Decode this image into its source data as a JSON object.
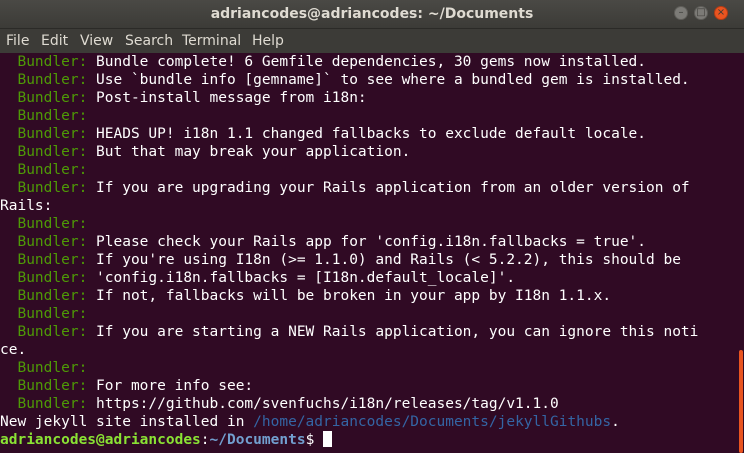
{
  "window": {
    "title": "adriancodes@adriancodes: ~/Documents"
  },
  "menu": [
    "File",
    "Edit",
    "View",
    "Search",
    "Terminal",
    "Help"
  ],
  "terminal": {
    "lines": [
      {
        "label": "  Bundler: ",
        "text": "Bundle complete! 6 Gemfile dependencies, 30 gems now installed."
      },
      {
        "label": "  Bundler: ",
        "text": "Use `bundle info [gemname]` to see where a bundled gem is installed."
      },
      {
        "label": "  Bundler: ",
        "text": "Post-install message from i18n:"
      },
      {
        "label": "  Bundler: ",
        "text": ""
      },
      {
        "label": "  Bundler: ",
        "text": "HEADS UP! i18n 1.1 changed fallbacks to exclude default locale."
      },
      {
        "label": "  Bundler: ",
        "text": "But that may break your application."
      },
      {
        "label": "  Bundler: ",
        "text": ""
      },
      {
        "label": "  Bundler: ",
        "text": "If you are upgrading your Rails application from an older version of"
      },
      {
        "label": "",
        "text": "Rails:"
      },
      {
        "label": "  Bundler: ",
        "text": ""
      },
      {
        "label": "  Bundler: ",
        "text": "Please check your Rails app for 'config.i18n.fallbacks = true'."
      },
      {
        "label": "  Bundler: ",
        "text": "If you're using I18n (>= 1.1.0) and Rails (< 5.2.2), this should be"
      },
      {
        "label": "  Bundler: ",
        "text": "'config.i18n.fallbacks = [I18n.default_locale]'."
      },
      {
        "label": "  Bundler: ",
        "text": "If not, fallbacks will be broken in your app by I18n 1.1.x."
      },
      {
        "label": "  Bundler: ",
        "text": ""
      },
      {
        "label": "  Bundler: ",
        "text": "If you are starting a NEW Rails application, you can ignore this noti"
      },
      {
        "label": "",
        "text": "ce."
      },
      {
        "label": "  Bundler: ",
        "text": ""
      },
      {
        "label": "  Bundler: ",
        "text": "For more info see:"
      },
      {
        "label": "  Bundler: ",
        "text": "https://github.com/svenfuchs/i18n/releases/tag/v1.1.0"
      }
    ],
    "new_site_prefix": "New jekyll site installed in ",
    "new_site_path": "/home/adriancodes/Documents/jekyllGithubs",
    "new_site_suffix": ".",
    "prompt_user": "adriancodes@adriancodes",
    "prompt_sep": ":",
    "prompt_path": "~/Documents",
    "prompt_symbol": "$ "
  }
}
